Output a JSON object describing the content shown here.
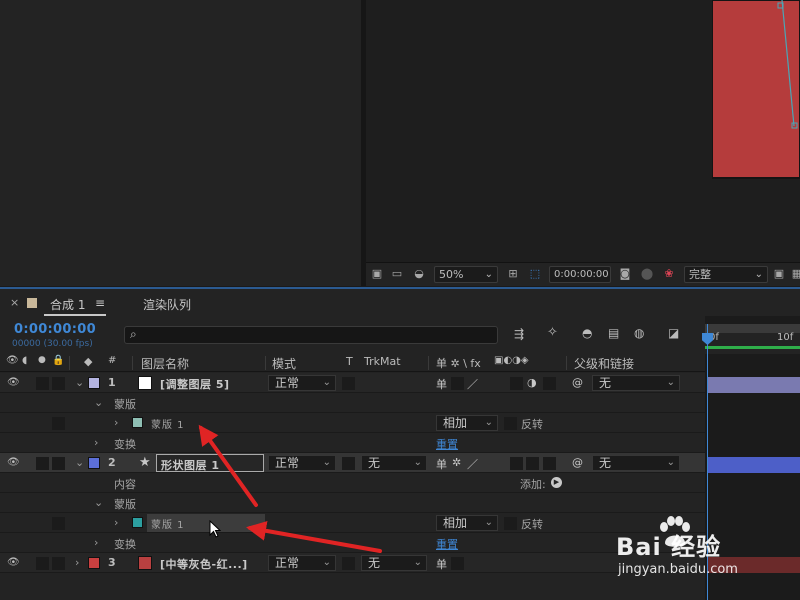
{
  "viewer": {
    "zoom": "50%",
    "timecode": "0:00:00:00",
    "quality": "完整"
  },
  "timeline": {
    "tab_close": "×",
    "tab_comp": "合成 1",
    "tab_menu": "≡",
    "tab_render": "渲染队列",
    "timecode": "0:00:00:00",
    "fps": "00000 (30.00 fps)",
    "search_icon": "⌕",
    "headers": {
      "hash": "#",
      "layer_name": "图层名称",
      "mode": "模式",
      "t": "T",
      "trkmat": "TrkMat",
      "switches": "单 ✲ \\ fx",
      "parent": "父级和链接"
    },
    "ruler": {
      "label_0": "0f",
      "label_10": "10f"
    }
  },
  "rows": {
    "layer1": {
      "num": "1",
      "name": "[调整图层 5]",
      "mode": "正常",
      "parent": "无",
      "label_color": "#b4b4e0",
      "swatch_color": "#ffffff"
    },
    "mask_group_1": {
      "label": "蒙版"
    },
    "mask_1": {
      "name": "蒙版 1",
      "mode": "相加",
      "invert": "反转",
      "color": "#8fbfb4"
    },
    "transform_1": {
      "label": "变换",
      "reset": "重置"
    },
    "layer2": {
      "num": "2",
      "name": "形状图层 1",
      "mode": "正常",
      "trkmat": "无",
      "parent": "无",
      "label_color": "#5c6fd8",
      "star": "★"
    },
    "contents_2": {
      "label": "内容",
      "add": "添加:"
    },
    "mask_group_2": {
      "label": "蒙版"
    },
    "mask_2": {
      "name": "蒙版 1",
      "mode": "相加",
      "invert": "反转",
      "color": "#2c9fa0"
    },
    "transform_2": {
      "label": "变换",
      "reset": "重置"
    },
    "layer3": {
      "num": "3",
      "name": "[中等灰色-红...]",
      "mode": "正常",
      "trkmat": "无",
      "label_color": "#c94040",
      "swatch_color": "#b94040"
    }
  },
  "watermark": {
    "brand": "Bai 经验",
    "url": "jingyan.baidu.com"
  },
  "colors": {
    "accent_blue": "#3f88d6",
    "arrow_red": "#e02424",
    "comp_red": "#b53c3c"
  }
}
